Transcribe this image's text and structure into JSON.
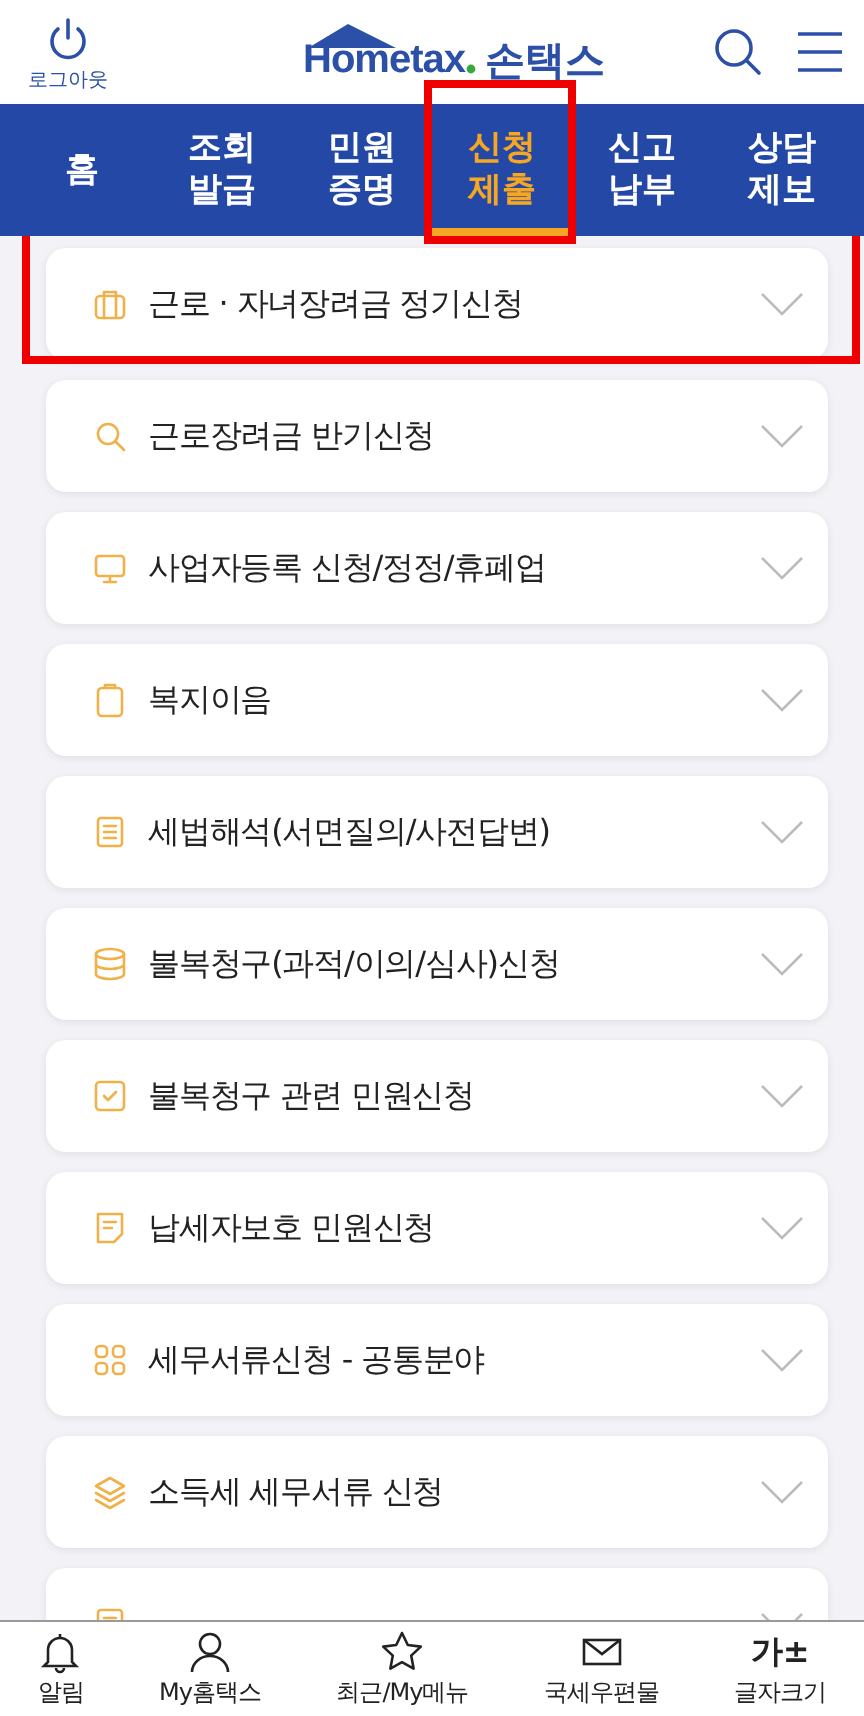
{
  "header": {
    "logout_label": "로그아웃",
    "logo_text": "Hometax",
    "app_name": "손택스"
  },
  "tabs": [
    {
      "lines": [
        "홈"
      ],
      "selected": false,
      "highlighted": false
    },
    {
      "lines": [
        "조회",
        "발급"
      ],
      "selected": false,
      "highlighted": false
    },
    {
      "lines": [
        "민원",
        "증명"
      ],
      "selected": false,
      "highlighted": false
    },
    {
      "lines": [
        "신청",
        "제출"
      ],
      "selected": true,
      "highlighted": true
    },
    {
      "lines": [
        "신고",
        "납부"
      ],
      "selected": false,
      "highlighted": false
    },
    {
      "lines": [
        "상담",
        "제보"
      ],
      "selected": false,
      "highlighted": false
    }
  ],
  "menu_items": [
    {
      "kind": "briefcase",
      "label": "근로 · 자녀장려금 정기신청",
      "highlighted": true
    },
    {
      "kind": "search",
      "label": "근로장려금 반기신청",
      "highlighted": false
    },
    {
      "kind": "monitor",
      "label": "사업자등록 신청/정정/휴폐업",
      "highlighted": false
    },
    {
      "kind": "clipboard",
      "label": "복지이음",
      "highlighted": false
    },
    {
      "kind": "document",
      "label": "세법해석(서면질의/사전답변)",
      "highlighted": false
    },
    {
      "kind": "database",
      "label": "불복청구(과적/이의/심사)신청",
      "highlighted": false
    },
    {
      "kind": "checkbox",
      "label": "불복청구 관련 민원신청",
      "highlighted": false
    },
    {
      "kind": "note",
      "label": "납세자보호 민원신청",
      "highlighted": false
    },
    {
      "kind": "grid",
      "label": "세무서류신청 - 공통분야",
      "highlighted": false
    },
    {
      "kind": "layers",
      "label": "소득세 세무서류 신청",
      "highlighted": false
    },
    {
      "kind": "document",
      "highlighted": false
    }
  ],
  "bottom_nav": [
    {
      "kind": "bell",
      "label": "알림"
    },
    {
      "kind": "person",
      "label": "My홈택스"
    },
    {
      "kind": "star",
      "label": "최근/My메뉴"
    },
    {
      "kind": "envelope",
      "label": "국세우편물"
    },
    {
      "kind": "text",
      "glyph": "가±",
      "label": "글자크기"
    }
  ]
}
